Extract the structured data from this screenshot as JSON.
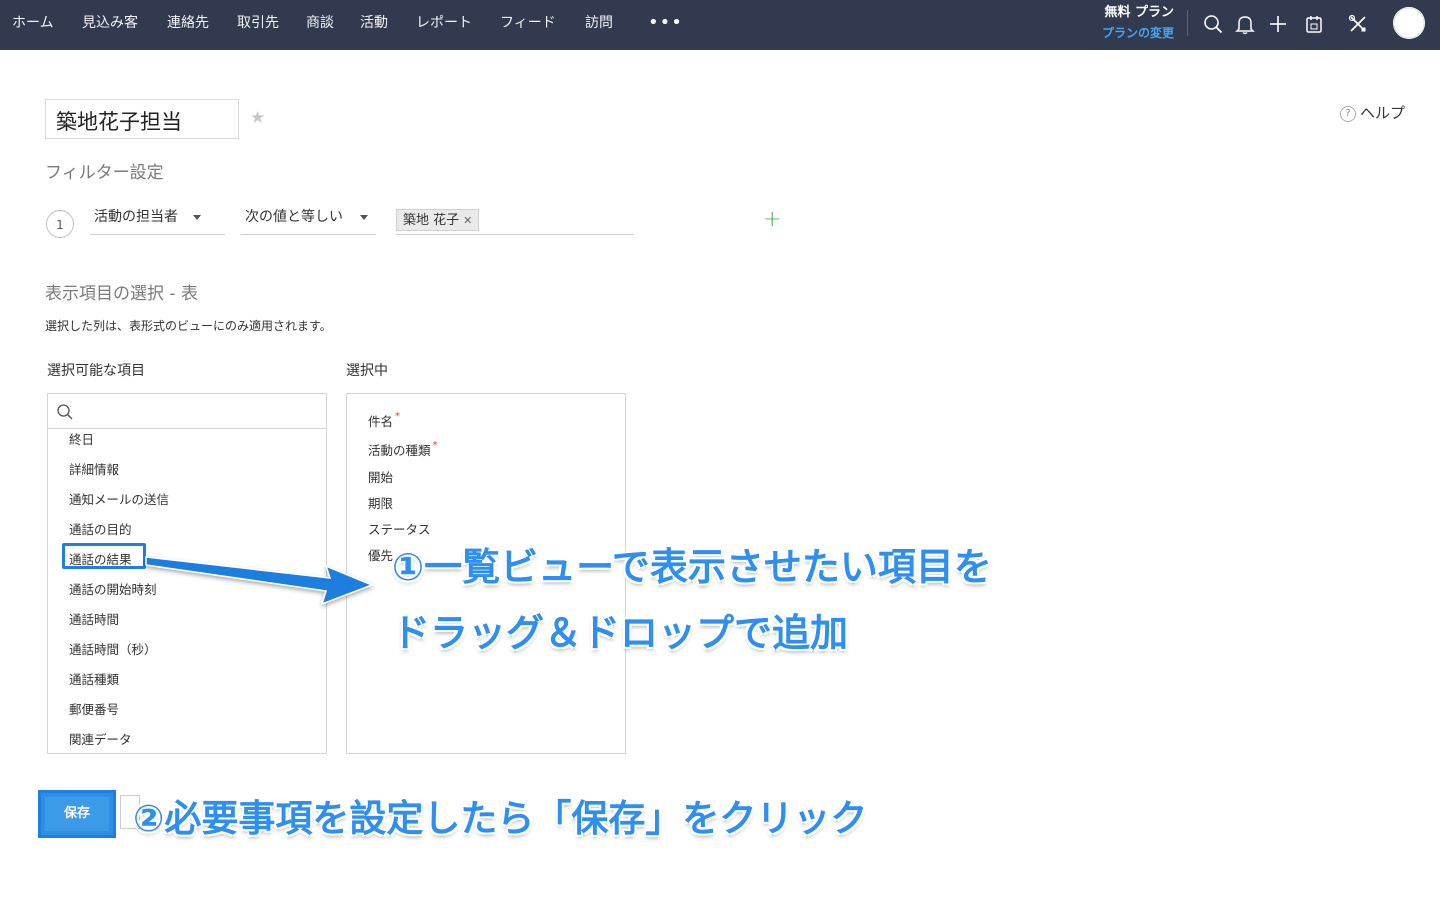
{
  "nav": {
    "items": [
      "ホーム",
      "見込み客",
      "連絡先",
      "取引先",
      "商談",
      "活動",
      "レポート",
      "フィード",
      "訪問"
    ],
    "more": "•••",
    "plan_label": "無料 プラン",
    "plan_link": "プランの変更",
    "icons": [
      "search-icon",
      "bell-icon",
      "plus-icon",
      "calendar-icon",
      "tools-icon"
    ]
  },
  "view": {
    "name": "築地花子担当",
    "help": "ヘルプ"
  },
  "filter": {
    "title": "フィルター設定",
    "criteria_number": "1",
    "field": "活動の担当者",
    "operator": "次の値と等しい",
    "value_chip": "築地 花子"
  },
  "columns": {
    "title": "表示項目の選択 - 表",
    "note": "選択した列は、表形式のビューにのみ適用されます。",
    "available_title": "選択可能な項目",
    "selected_title": "選択中",
    "available": [
      "終日",
      "詳細情報",
      "通知メールの送信",
      "通話の目的",
      "通話の結果",
      "通話の開始時刻",
      "通話時間",
      "通話時間（秒）",
      "通話種類",
      "郵便番号",
      "関連データ"
    ],
    "selected": [
      {
        "label": "件名",
        "required": "*"
      },
      {
        "label": "活動の種類",
        "required": "*"
      },
      {
        "label": "開始",
        "required": ""
      },
      {
        "label": "期限",
        "required": ""
      },
      {
        "label": "ステータス",
        "required": ""
      },
      {
        "label": "優先",
        "required": ""
      }
    ]
  },
  "buttons": {
    "save": "保存"
  },
  "annotations": {
    "step1_line1": "①一覧ビューで表示させたい項目を",
    "step1_line2": "ドラッグ＆ドロップで追加",
    "step2": "②必要事項を設定したら「保存」をクリック"
  },
  "colors": {
    "nav_bg": "#313a4e",
    "annotation": "#2e8ff0",
    "link": "#4aa3f0",
    "add": "#4caf50"
  }
}
